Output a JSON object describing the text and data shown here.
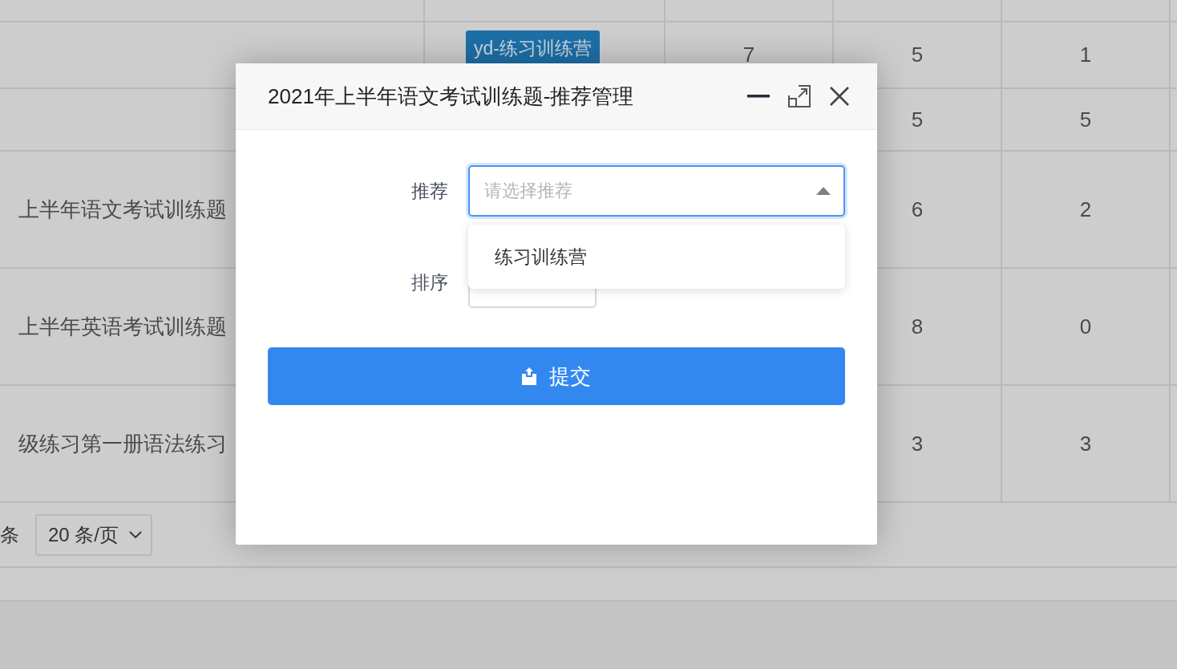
{
  "table": {
    "rows": [
      {
        "tag": "yd-练习训练营",
        "column_3": "7",
        "column_4": "5",
        "column_5": "1"
      },
      {
        "column_4": "5",
        "column_5": "5"
      },
      {
        "column_1": "上半年语文考试训练题",
        "column_4": "6",
        "column_5": "2"
      },
      {
        "column_1": "上半年英语考试训练题",
        "column_4": "8",
        "column_5": "0"
      },
      {
        "column_1": "级练习第一册语法练习",
        "column_4": "3",
        "column_5": "3"
      }
    ]
  },
  "pagination": {
    "total_suffix": "条",
    "page_size": "20 条/页"
  },
  "dialog": {
    "title": "2021年上半年语文考试训练题-推荐管理",
    "fields": [
      {
        "kind": "select",
        "label": "推荐",
        "placeholder": "请选择推荐",
        "expanded": true,
        "options": [
          "练习训练营"
        ]
      },
      {
        "kind": "input",
        "label": "排序"
      }
    ],
    "submit": "提交"
  }
}
